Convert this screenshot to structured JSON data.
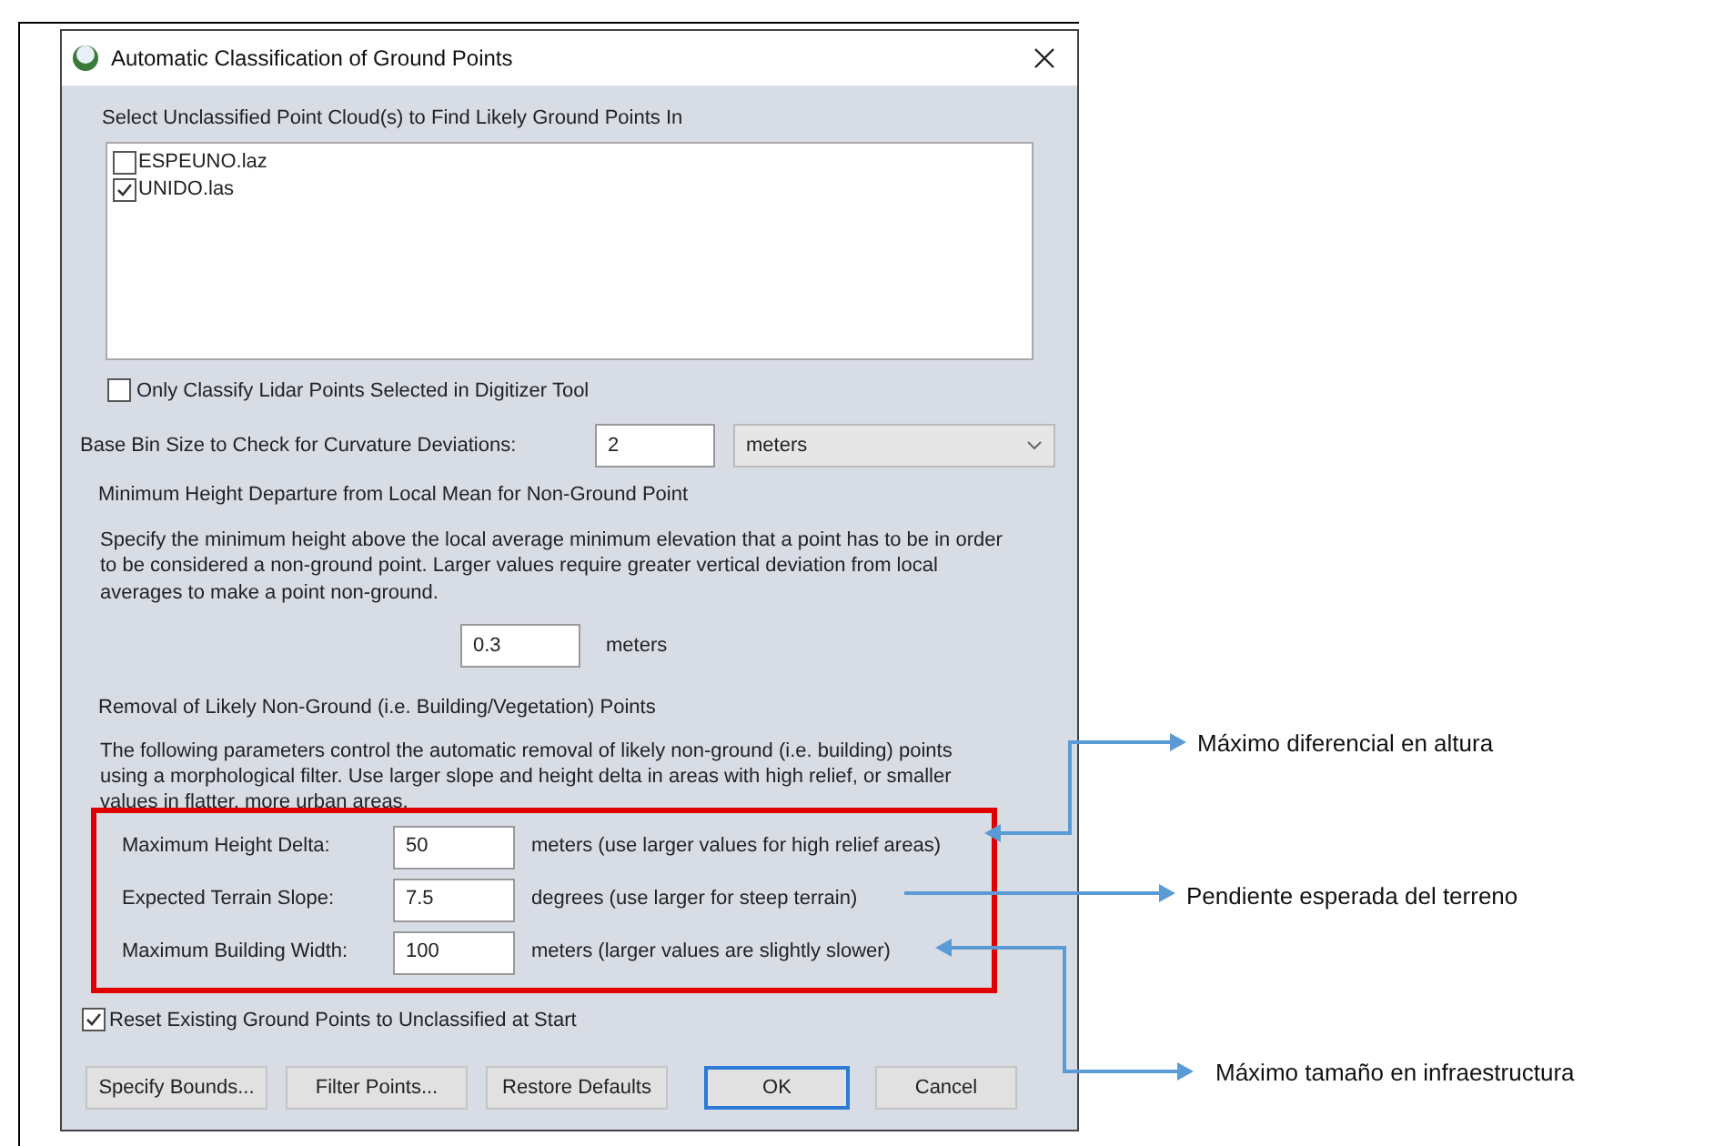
{
  "window": {
    "title": "Automatic Classification of Ground Points"
  },
  "point_clouds": {
    "label": "Select Unclassified Point Cloud(s) to Find Likely Ground Points In",
    "items": [
      {
        "name": "ESPEUNO.laz",
        "checked": false
      },
      {
        "name": "UNIDO.las",
        "checked": true
      }
    ]
  },
  "only_selected": {
    "label": "Only Classify Lidar Points Selected in Digitizer Tool",
    "checked": false
  },
  "base_bin": {
    "label": "Base Bin Size to Check for Curvature Deviations:",
    "value": "2",
    "unit": "meters"
  },
  "min_height": {
    "title": "Minimum Height Departure from Local Mean for Non-Ground Point",
    "description": "Specify the minimum height above the local average minimum elevation that a point has to be in order to be considered a non-ground point. Larger values require greater vertical deviation from local averages to make a point non-ground.",
    "value": "0.3",
    "unit": "meters"
  },
  "removal": {
    "title": "Removal of Likely Non-Ground (i.e. Building/Vegetation) Points",
    "description": "The following parameters control the automatic removal of likely non-ground (i.e. building) points using a morphological filter. Use larger slope and height delta in areas with high relief, or smaller values in flatter, more urban areas.",
    "highlighted": true,
    "params": [
      {
        "label": "Maximum Height Delta:",
        "value": "50",
        "hint": "meters (use larger values for high relief areas)"
      },
      {
        "label": "Expected Terrain Slope:",
        "value": "7.5",
        "hint": "degrees (use larger for steep terrain)"
      },
      {
        "label": "Maximum Building Width:",
        "value": "100",
        "hint": "meters (larger values are slightly slower)"
      }
    ]
  },
  "reset": {
    "label": "Reset Existing Ground Points to Unclassified at Start",
    "checked": true
  },
  "buttons": [
    {
      "label": "Specify Bounds...",
      "default": false
    },
    {
      "label": "Filter Points...",
      "default": false
    },
    {
      "label": "Restore Defaults",
      "default": false
    },
    {
      "label": "OK",
      "default": true
    },
    {
      "label": "Cancel",
      "default": false
    }
  ],
  "annotations": [
    {
      "text": "Máximo diferencial en altura"
    },
    {
      "text": "Pendiente esperada del terreno"
    },
    {
      "text": "Máximo tamaño en infraestructura"
    }
  ]
}
